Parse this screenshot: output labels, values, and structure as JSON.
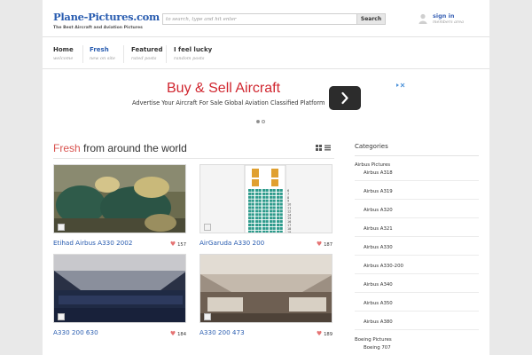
{
  "header": {
    "logo": "Plane-Pictures.com",
    "tagline": "The Best Aircraft and Aviation Pictures",
    "search_placeholder": "to search, type and hit enter",
    "search_button": "Search",
    "signin": "sign in",
    "signin_sub": "members area"
  },
  "nav": [
    {
      "label": "Home",
      "sub": "welcome",
      "active": false
    },
    {
      "label": "Fresh",
      "sub": "new on site",
      "active": true
    },
    {
      "label": "Featured",
      "sub": "rated posts",
      "active": false
    },
    {
      "label": "I feel lucky",
      "sub": "random posts",
      "active": false
    }
  ],
  "ad": {
    "title": "Buy & Sell Aircraft",
    "text": "Advertise Your Aircraft For Sale Global Aviation Classified Platform"
  },
  "section": {
    "title_highlight": "Fresh",
    "title_rest": " from around the world"
  },
  "posts": [
    {
      "title": "Etihad Airbus A330 2002",
      "likes": "157"
    },
    {
      "title": "AirGaruda A330 200",
      "likes": "187"
    },
    {
      "title": "A330 200 630",
      "likes": "184"
    },
    {
      "title": "A330 200 473",
      "likes": "189"
    }
  ],
  "seat_rows": [
    "6",
    "7",
    "8",
    "9",
    "10",
    "11",
    "12",
    "14",
    "15",
    "16",
    "17",
    "18",
    "19"
  ],
  "sidebar": {
    "heading": "Categories",
    "groups": [
      {
        "name": "Airbus Pictures",
        "items": [
          "Airbus A318",
          "Airbus A319",
          "Airbus A320",
          "Airbus A321",
          "Airbus A330",
          "Airbus A330-200",
          "Airbus A340",
          "Airbus A350",
          "Airbus A380"
        ]
      },
      {
        "name": "Boeing Pictures",
        "items": [
          "Boeing 707"
        ]
      }
    ]
  }
}
